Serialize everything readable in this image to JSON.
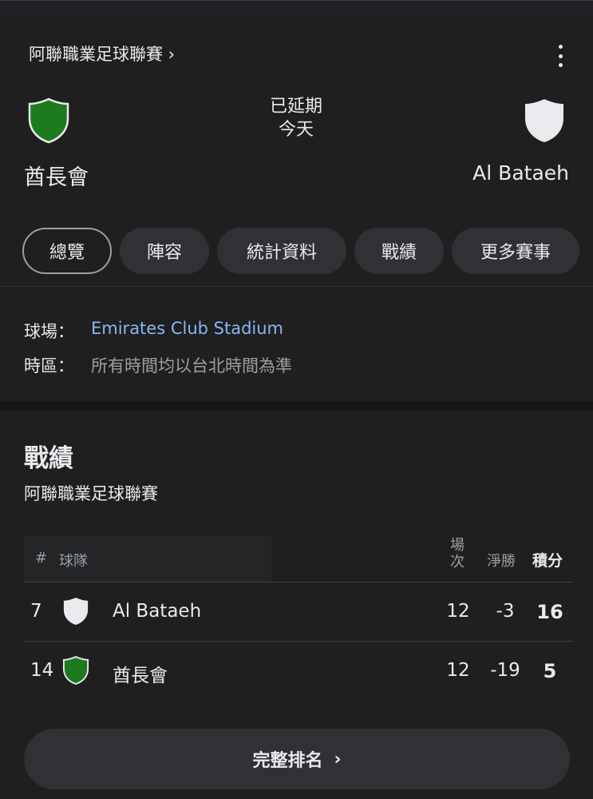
{
  "match": {
    "league_link": "阿聯職業足球聯賽 ›",
    "status": "已延期",
    "date": "今天",
    "home": {
      "name": "酋長會",
      "shield_color": "#1e7a1e"
    },
    "away": {
      "name": "Al Bataeh",
      "shield_color": "#e8eaed"
    }
  },
  "tabs": [
    {
      "label": "總覽",
      "active": true
    },
    {
      "label": "陣容"
    },
    {
      "label": "統計資料"
    },
    {
      "label": "戰績"
    },
    {
      "label": "更多賽事"
    }
  ],
  "info": {
    "venue_label": "球場：",
    "venue_value": "Emirates Club Stadium",
    "tz_label": "時區：",
    "tz_value": "所有時間均以台北時間為準"
  },
  "standings": {
    "title": "戰績",
    "subtitle": "阿聯職業足球聯賽",
    "headers": {
      "rank": "#",
      "team": "球隊",
      "played": "場次",
      "gd": "淨勝",
      "pts": "積分"
    },
    "rows": [
      {
        "rank": "7",
        "team": "Al Bataeh",
        "played": "12",
        "gd": "-3",
        "pts": "16",
        "shield_color": "#e8eaed"
      },
      {
        "rank": "14",
        "team": "酋長會",
        "played": "12",
        "gd": "-19",
        "pts": "5",
        "shield_color": "#1e7a1e"
      }
    ],
    "full_button": "完整排名"
  },
  "icons": {
    "more": "more-vert-icon",
    "chevron": "chevron-right-icon",
    "shield": "team-shield-icon"
  }
}
